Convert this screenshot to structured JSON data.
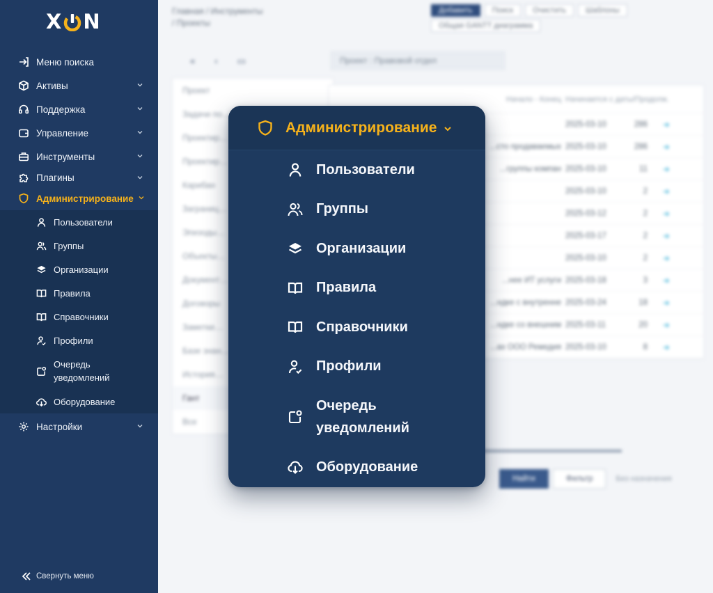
{
  "brand": {
    "logo_left": "X",
    "logo_right": "N",
    "accent": "#f6b21b",
    "sidebar_bg": "#1f3a62"
  },
  "sidebar": {
    "items": [
      {
        "label": "Меню поиска",
        "icon": "login-arrow-icon"
      },
      {
        "label": "Активы",
        "icon": "cube-icon"
      },
      {
        "label": "Поддержка",
        "icon": "headset-icon"
      },
      {
        "label": "Управление",
        "icon": "wallet-icon"
      },
      {
        "label": "Инструменты",
        "icon": "toolbox-icon"
      },
      {
        "label": "Плагины",
        "icon": "puzzle-icon"
      },
      {
        "label": "Администрирование",
        "icon": "shield-icon"
      },
      {
        "label": "Настройки",
        "icon": "gear-icon"
      }
    ],
    "admin_sub": [
      {
        "label": "Пользователи",
        "icon": "user-icon"
      },
      {
        "label": "Группы",
        "icon": "users-icon"
      },
      {
        "label": "Организации",
        "icon": "layers-icon"
      },
      {
        "label": "Правила",
        "icon": "book-icon"
      },
      {
        "label": "Справочники",
        "icon": "book-icon"
      },
      {
        "label": "Профили",
        "icon": "user-check-icon"
      },
      {
        "label": "Очередь\nуведомлений",
        "icon": "notification-icon"
      },
      {
        "label": "Оборудование",
        "icon": "cloud-download-icon"
      }
    ],
    "collapse_label": "Свернуть меню"
  },
  "popup": {
    "title": "Администрирование",
    "items": [
      {
        "label": "Пользователи",
        "icon": "user-icon"
      },
      {
        "label": "Группы",
        "icon": "users-icon"
      },
      {
        "label": "Организации",
        "icon": "layers-icon"
      },
      {
        "label": "Правила",
        "icon": "book-icon"
      },
      {
        "label": "Справочники",
        "icon": "book-icon"
      },
      {
        "label": "Профили",
        "icon": "user-check-icon"
      },
      {
        "label": "Очередь\nуведомлений",
        "icon": "notification-icon"
      },
      {
        "label": "Оборудование",
        "icon": "cloud-download-icon"
      }
    ]
  },
  "background": {
    "crumb_1": "Главная / Инструменты",
    "crumb_2": "/ Проекты",
    "buttons": [
      "Добавить",
      "Поиск",
      "Очистить",
      "Шаблоны"
    ],
    "button_gantt": "Общая GANTT диаграмма",
    "project_box": "Проект : Правовой отдел",
    "left_list": [
      "Проект",
      "Задачи по…",
      "Проектир…",
      "Проектир…",
      "Карибан",
      "Заграниц…",
      "Эпизоды…",
      "Объекты…",
      "Документ…",
      "Договоры",
      "Заметки…",
      "Базе знан…",
      "История…",
      "Гант",
      "Все"
    ],
    "table_head": {
      "c1": "Начало - Конец",
      "c2": "Начинается с даты/Продолж."
    },
    "rows": [
      {
        "c1": "",
        "c2": "2025-03-10",
        "c3": "286"
      },
      {
        "c1": "...сто продаваемых",
        "c2": "2025-03-10",
        "c3": "286"
      },
      {
        "c1": "...группы компан",
        "c2": "2025-03-10",
        "c3": "11"
      },
      {
        "c1": "",
        "c2": "2025-03-10",
        "c3": "2"
      },
      {
        "c1": "",
        "c2": "2025-03-12",
        "c3": "2"
      },
      {
        "c1": "",
        "c2": "2025-03-17",
        "c3": "2"
      },
      {
        "c1": "",
        "c2": "2025-03-10",
        "c3": "2"
      },
      {
        "c1": "...нее ИТ услуги",
        "c2": "2025-03-18",
        "c3": "3"
      },
      {
        "c1": "...ндке с внутренне",
        "c2": "2025-03-24",
        "c3": "18"
      },
      {
        "c1": "...ндке со внешним",
        "c2": "2025-03-11",
        "c3": "20"
      },
      {
        "c1": "...ах ООО Ремедия",
        "c2": "2025-03-10",
        "c3": "8"
      }
    ],
    "bottom_buttons": [
      "Найти",
      "Фильтр"
    ],
    "bottom_text": "Без назначения"
  }
}
